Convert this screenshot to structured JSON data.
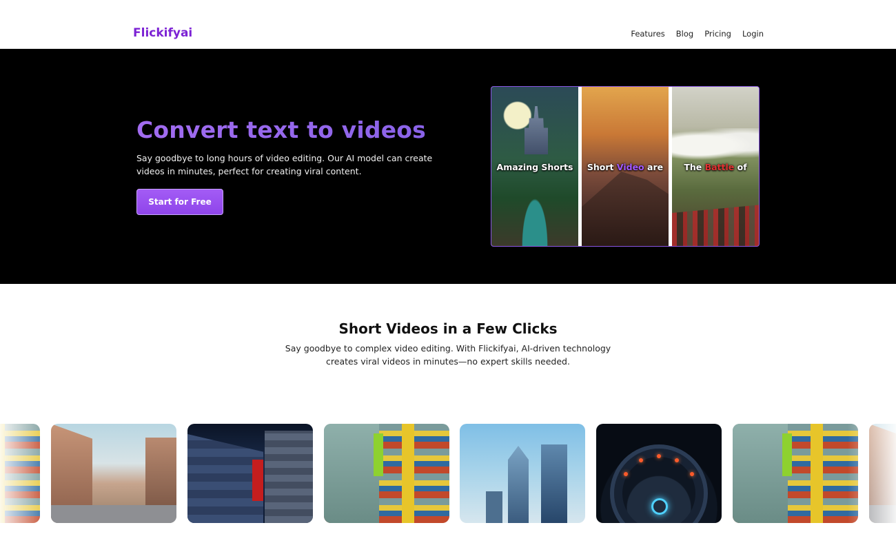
{
  "nav": {
    "logo": "Flickifyai",
    "links": [
      "Features",
      "Blog",
      "Pricing",
      "Login"
    ]
  },
  "hero": {
    "title": "Convert text to videos",
    "subtitle": "Say goodbye to long hours of video editing. Our AI model can create videos in minutes, perfect for creating viral content.",
    "cta": "Start for Free",
    "reel": [
      {
        "caption_parts": [
          "Amazing Shorts"
        ]
      },
      {
        "caption_parts": [
          "Short ",
          "Video",
          " are"
        ]
      },
      {
        "caption_parts": [
          "The ",
          "Battle",
          " of"
        ]
      }
    ]
  },
  "section": {
    "title": "Short Videos in a Few Clicks",
    "subtitle": "Say goodbye to complex video editing. With Flickifyai, AI-driven technology creates viral videos in minutes—no expert skills needed."
  },
  "gallery": {
    "items": [
      "lego-street",
      "city-street",
      "voxel-corridor",
      "lego-street",
      "skyscrapers",
      "sci-fi-portal",
      "lego-street",
      "city-street"
    ]
  },
  "colors": {
    "brand": "#7c22d4",
    "accent": "#9b59f3",
    "hero_bg": "#000000",
    "highlight_red": "#e23232"
  }
}
